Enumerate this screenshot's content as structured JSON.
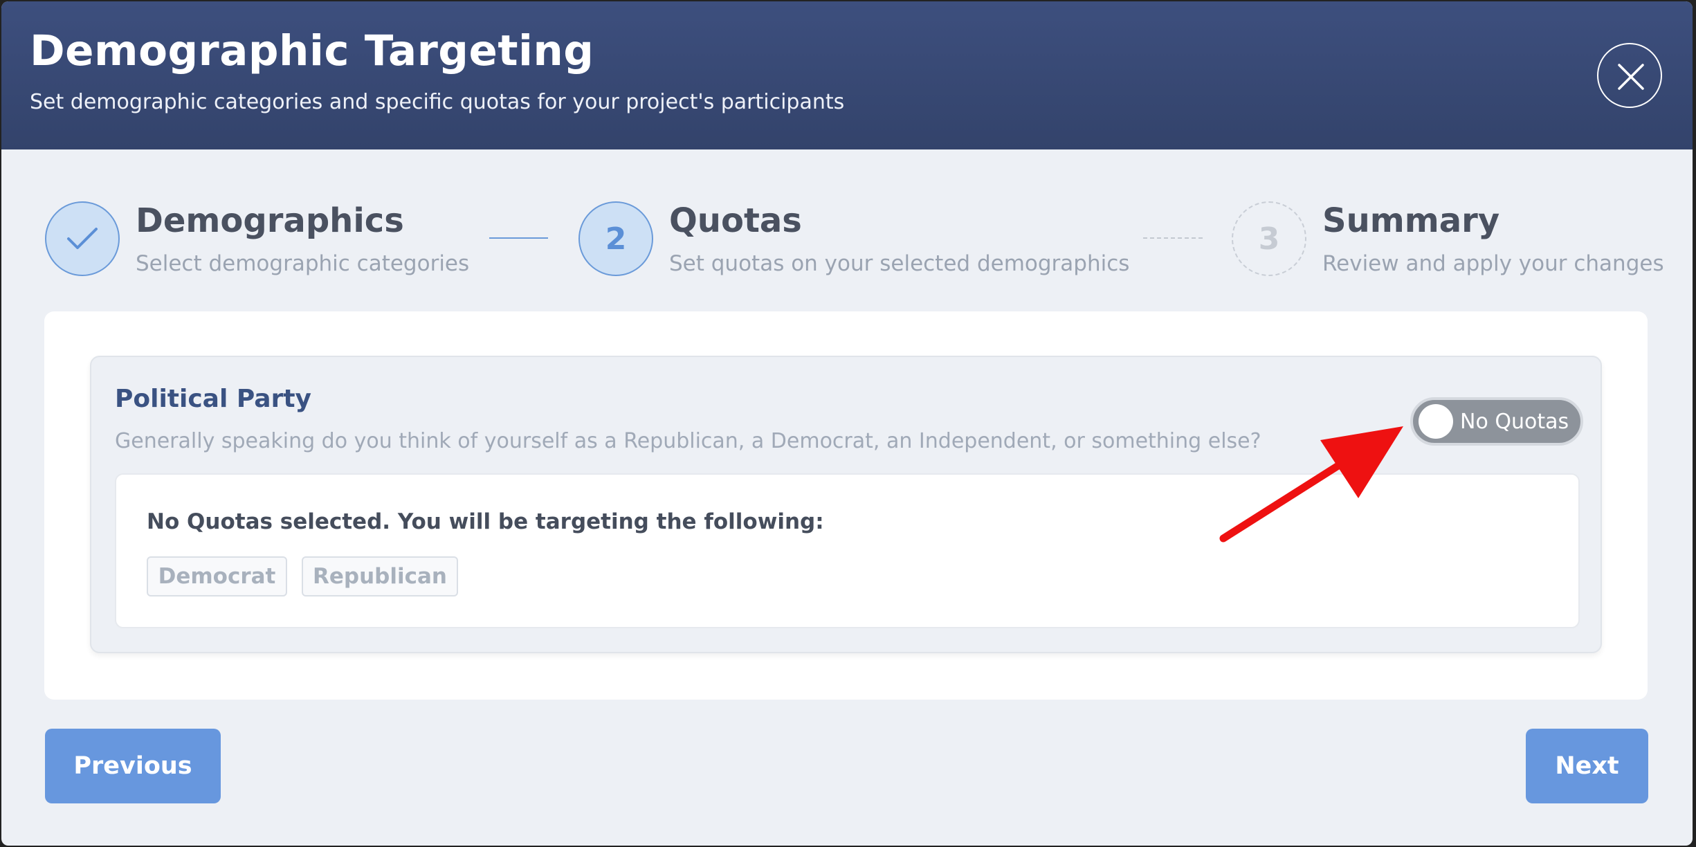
{
  "header": {
    "title": "Demographic Targeting",
    "subtitle": "Set demographic categories and specific quotas for your project's participants",
    "close_icon": "close-icon"
  },
  "stepper": {
    "steps": [
      {
        "label": "Demographics",
        "description": "Select demographic categories",
        "state": "completed",
        "marker": ""
      },
      {
        "label": "Quotas",
        "description": "Set quotas on your selected demographics",
        "state": "active",
        "marker": "2"
      },
      {
        "label": "Summary",
        "description": "Review and apply your changes",
        "state": "pending",
        "marker": "3"
      }
    ]
  },
  "category": {
    "title": "Political Party",
    "question": "Generally speaking do you think of yourself as a Republican, a Democrat, an Independent, or something else?",
    "toggle_label": "No Quotas",
    "toggle_on": false,
    "selection_message": "No Quotas selected. You will be targeting the following:",
    "chips": [
      "Democrat",
      "Republican"
    ]
  },
  "footer": {
    "previous_label": "Previous",
    "next_label": "Next"
  },
  "colors": {
    "header": "#3a4b78",
    "accent": "#6797de",
    "annotation_arrow": "#ee1111"
  }
}
